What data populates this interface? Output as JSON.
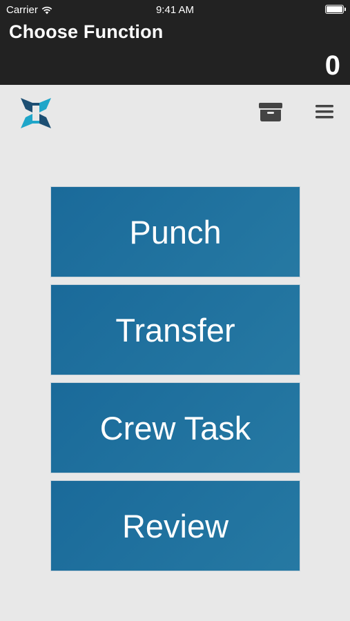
{
  "status_bar": {
    "carrier": "Carrier",
    "time": "9:41 AM",
    "wifi_icon": "wifi-icon",
    "battery_icon": "battery-icon"
  },
  "header": {
    "title": "Choose Function",
    "count": "0"
  },
  "toolbar": {
    "logo_icon": "app-logo",
    "archive_icon": "archive-box-icon",
    "menu_icon": "hamburger-menu-icon"
  },
  "functions": [
    {
      "label": "Punch"
    },
    {
      "label": "Transfer"
    },
    {
      "label": "Crew Task"
    },
    {
      "label": "Review"
    }
  ],
  "colors": {
    "header_bg": "#222222",
    "page_bg": "#e8e8e8",
    "button_bg": "#1f72a0",
    "logo_dark": "#1d4f73",
    "logo_accent": "#1fa6c9"
  }
}
